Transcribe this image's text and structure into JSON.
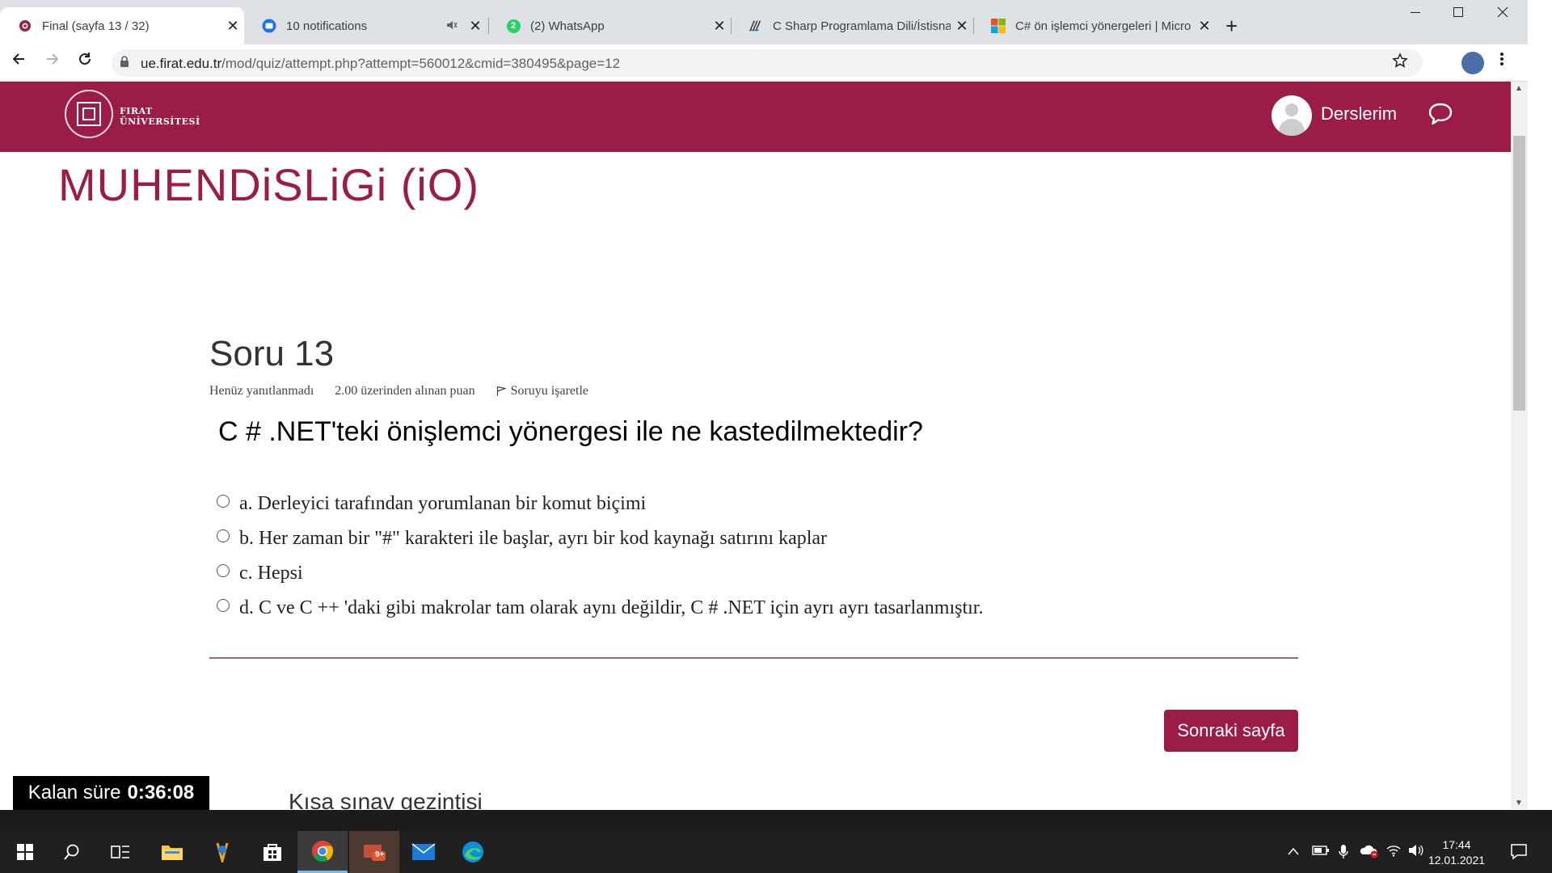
{
  "browser": {
    "tabs": [
      {
        "title": "Final (sayfa 13 / 32)",
        "close": "✕",
        "active": true
      },
      {
        "title": "10 notifications",
        "close": "✕",
        "active": false
      },
      {
        "title": "(2) WhatsApp",
        "close": "✕",
        "active": false
      },
      {
        "title": "C Sharp Programlama Dili/İstisna",
        "close": "✕",
        "active": false
      },
      {
        "title": "C# ön işlemci yönergeleri | Micro",
        "close": "✕",
        "active": false
      }
    ],
    "new_tab": "+",
    "url_host": "ue.firat.edu.tr",
    "url_path": "/mod/quiz/attempt.php?attempt=560012&cmid=380495&page=12",
    "whatsapp_badge": "2"
  },
  "header": {
    "logo_line1": "FIRAT",
    "logo_line2": "ÜNİVERSİTESİ",
    "my_courses": "Derslerim"
  },
  "course": {
    "title": "MUHENDiSLiGi (iO)"
  },
  "question": {
    "number_label": "Soru 13",
    "status": "Henüz yanıtlanmadı",
    "points": "2.00 üzerinden alınan puan",
    "flag_label": "Soruyu işaretle",
    "text": "C # .NET'teki önişlemci yönergesi ile ne kastedilmektedir?",
    "answers": [
      "a. Derleyici tarafından yorumlanan bir komut biçimi",
      "b. Her zaman bir \"#\" karakteri ile başlar, ayrı bir kod kaynağı satırını kaplar",
      "c. Hepsi",
      "d. C ve C ++ 'daki gibi makrolar tam olarak aynı değildir, C # .NET için ayrı ayrı tasarlanmıştır."
    ]
  },
  "navigation": {
    "next_page": "Sonraki sayfa",
    "quiz_nav_title": "Kısa sınav gezintisi"
  },
  "timer": {
    "label": "Kalan süre",
    "value": "0:36:08"
  },
  "taskbar": {
    "mail_badge": "9+",
    "time": "17:44",
    "date": "12.01.2021"
  },
  "colors": {
    "brand": "#9b1d47",
    "tabstrip": "#dee1e6",
    "taskbar": "#202020"
  }
}
